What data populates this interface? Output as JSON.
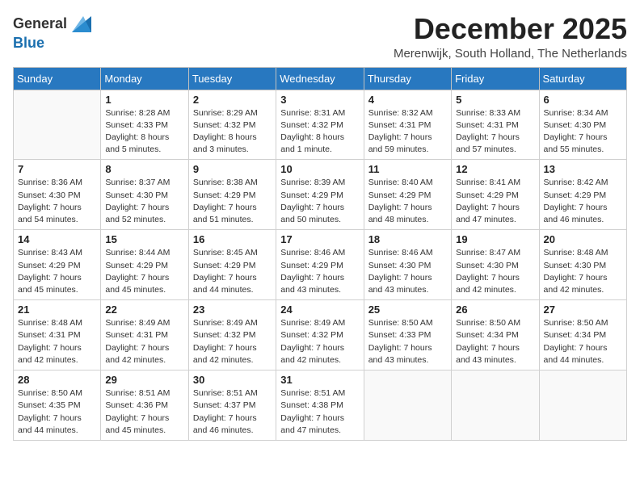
{
  "logo": {
    "general": "General",
    "blue": "Blue"
  },
  "header": {
    "month_title": "December 2025",
    "location": "Merenwijk, South Holland, The Netherlands"
  },
  "weekdays": [
    "Sunday",
    "Monday",
    "Tuesday",
    "Wednesday",
    "Thursday",
    "Friday",
    "Saturday"
  ],
  "weeks": [
    [
      {
        "day": "",
        "info": ""
      },
      {
        "day": "1",
        "info": "Sunrise: 8:28 AM\nSunset: 4:33 PM\nDaylight: 8 hours\nand 5 minutes."
      },
      {
        "day": "2",
        "info": "Sunrise: 8:29 AM\nSunset: 4:32 PM\nDaylight: 8 hours\nand 3 minutes."
      },
      {
        "day": "3",
        "info": "Sunrise: 8:31 AM\nSunset: 4:32 PM\nDaylight: 8 hours\nand 1 minute."
      },
      {
        "day": "4",
        "info": "Sunrise: 8:32 AM\nSunset: 4:31 PM\nDaylight: 7 hours\nand 59 minutes."
      },
      {
        "day": "5",
        "info": "Sunrise: 8:33 AM\nSunset: 4:31 PM\nDaylight: 7 hours\nand 57 minutes."
      },
      {
        "day": "6",
        "info": "Sunrise: 8:34 AM\nSunset: 4:30 PM\nDaylight: 7 hours\nand 55 minutes."
      }
    ],
    [
      {
        "day": "7",
        "info": "Sunrise: 8:36 AM\nSunset: 4:30 PM\nDaylight: 7 hours\nand 54 minutes."
      },
      {
        "day": "8",
        "info": "Sunrise: 8:37 AM\nSunset: 4:30 PM\nDaylight: 7 hours\nand 52 minutes."
      },
      {
        "day": "9",
        "info": "Sunrise: 8:38 AM\nSunset: 4:29 PM\nDaylight: 7 hours\nand 51 minutes."
      },
      {
        "day": "10",
        "info": "Sunrise: 8:39 AM\nSunset: 4:29 PM\nDaylight: 7 hours\nand 50 minutes."
      },
      {
        "day": "11",
        "info": "Sunrise: 8:40 AM\nSunset: 4:29 PM\nDaylight: 7 hours\nand 48 minutes."
      },
      {
        "day": "12",
        "info": "Sunrise: 8:41 AM\nSunset: 4:29 PM\nDaylight: 7 hours\nand 47 minutes."
      },
      {
        "day": "13",
        "info": "Sunrise: 8:42 AM\nSunset: 4:29 PM\nDaylight: 7 hours\nand 46 minutes."
      }
    ],
    [
      {
        "day": "14",
        "info": "Sunrise: 8:43 AM\nSunset: 4:29 PM\nDaylight: 7 hours\nand 45 minutes."
      },
      {
        "day": "15",
        "info": "Sunrise: 8:44 AM\nSunset: 4:29 PM\nDaylight: 7 hours\nand 45 minutes."
      },
      {
        "day": "16",
        "info": "Sunrise: 8:45 AM\nSunset: 4:29 PM\nDaylight: 7 hours\nand 44 minutes."
      },
      {
        "day": "17",
        "info": "Sunrise: 8:46 AM\nSunset: 4:29 PM\nDaylight: 7 hours\nand 43 minutes."
      },
      {
        "day": "18",
        "info": "Sunrise: 8:46 AM\nSunset: 4:30 PM\nDaylight: 7 hours\nand 43 minutes."
      },
      {
        "day": "19",
        "info": "Sunrise: 8:47 AM\nSunset: 4:30 PM\nDaylight: 7 hours\nand 42 minutes."
      },
      {
        "day": "20",
        "info": "Sunrise: 8:48 AM\nSunset: 4:30 PM\nDaylight: 7 hours\nand 42 minutes."
      }
    ],
    [
      {
        "day": "21",
        "info": "Sunrise: 8:48 AM\nSunset: 4:31 PM\nDaylight: 7 hours\nand 42 minutes."
      },
      {
        "day": "22",
        "info": "Sunrise: 8:49 AM\nSunset: 4:31 PM\nDaylight: 7 hours\nand 42 minutes."
      },
      {
        "day": "23",
        "info": "Sunrise: 8:49 AM\nSunset: 4:32 PM\nDaylight: 7 hours\nand 42 minutes."
      },
      {
        "day": "24",
        "info": "Sunrise: 8:49 AM\nSunset: 4:32 PM\nDaylight: 7 hours\nand 42 minutes."
      },
      {
        "day": "25",
        "info": "Sunrise: 8:50 AM\nSunset: 4:33 PM\nDaylight: 7 hours\nand 43 minutes."
      },
      {
        "day": "26",
        "info": "Sunrise: 8:50 AM\nSunset: 4:34 PM\nDaylight: 7 hours\nand 43 minutes."
      },
      {
        "day": "27",
        "info": "Sunrise: 8:50 AM\nSunset: 4:34 PM\nDaylight: 7 hours\nand 44 minutes."
      }
    ],
    [
      {
        "day": "28",
        "info": "Sunrise: 8:50 AM\nSunset: 4:35 PM\nDaylight: 7 hours\nand 44 minutes."
      },
      {
        "day": "29",
        "info": "Sunrise: 8:51 AM\nSunset: 4:36 PM\nDaylight: 7 hours\nand 45 minutes."
      },
      {
        "day": "30",
        "info": "Sunrise: 8:51 AM\nSunset: 4:37 PM\nDaylight: 7 hours\nand 46 minutes."
      },
      {
        "day": "31",
        "info": "Sunrise: 8:51 AM\nSunset: 4:38 PM\nDaylight: 7 hours\nand 47 minutes."
      },
      {
        "day": "",
        "info": ""
      },
      {
        "day": "",
        "info": ""
      },
      {
        "day": "",
        "info": ""
      }
    ]
  ]
}
